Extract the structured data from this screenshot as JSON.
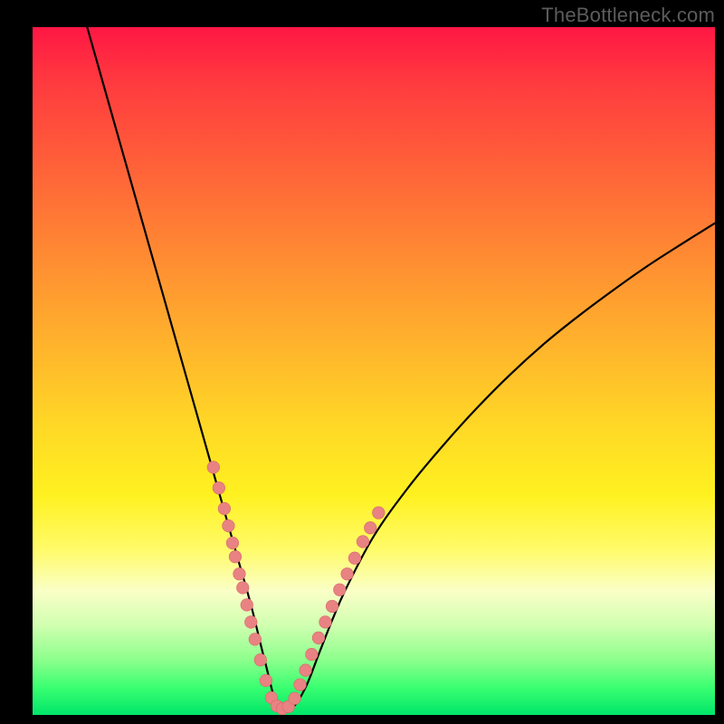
{
  "watermark": "TheBottleneck.com",
  "colors": {
    "background": "#000000",
    "curve": "#000000",
    "dot_fill": "#e98282",
    "dot_stroke": "#d46a6a"
  },
  "chart_data": {
    "type": "line",
    "title": "",
    "xlabel": "",
    "ylabel": "",
    "xlim": [
      0,
      100
    ],
    "ylim": [
      0,
      100
    ],
    "note": "V-shaped bottleneck curve; y appears to represent bottleneck percentage (100 at top, 0 at bottom). Minimum ≈0% near x≈36. Values estimated from pixel positions; no axis ticks or labels are shown in the image.",
    "series": [
      {
        "name": "bottleneck_curve",
        "x": [
          8,
          10,
          12,
          14,
          16,
          18,
          20,
          22,
          24,
          26,
          28,
          30,
          32,
          34,
          36,
          38,
          40,
          42,
          44,
          46,
          50,
          55,
          60,
          65,
          70,
          75,
          80,
          85,
          90,
          95,
          100
        ],
        "y": [
          100,
          93,
          86,
          79,
          72,
          65,
          58,
          51,
          44,
          37,
          30,
          23,
          16,
          8,
          1,
          1,
          4,
          9,
          14,
          18.5,
          26,
          33,
          39,
          44.5,
          49.5,
          54,
          58,
          61.7,
          65.2,
          68.4,
          71.5
        ]
      }
    ],
    "highlight_points": {
      "name": "dotted_segment",
      "note": "Pink/coral dotted overlay along the curve roughly between x≈26 and x≈48 (the lower portion of the V).",
      "points": [
        {
          "x": 26.5,
          "y": 36
        },
        {
          "x": 27.3,
          "y": 33
        },
        {
          "x": 28.1,
          "y": 30
        },
        {
          "x": 28.7,
          "y": 27.5
        },
        {
          "x": 29.3,
          "y": 25
        },
        {
          "x": 29.7,
          "y": 23
        },
        {
          "x": 30.3,
          "y": 20.5
        },
        {
          "x": 30.8,
          "y": 18.5
        },
        {
          "x": 31.4,
          "y": 16
        },
        {
          "x": 32.0,
          "y": 13.5
        },
        {
          "x": 32.6,
          "y": 11
        },
        {
          "x": 33.4,
          "y": 8
        },
        {
          "x": 34.2,
          "y": 5
        },
        {
          "x": 35.0,
          "y": 2.5
        },
        {
          "x": 35.8,
          "y": 1.3
        },
        {
          "x": 36.6,
          "y": 0.9
        },
        {
          "x": 37.5,
          "y": 1.2
        },
        {
          "x": 38.4,
          "y": 2.4
        },
        {
          "x": 39.2,
          "y": 4.4
        },
        {
          "x": 40.0,
          "y": 6.5
        },
        {
          "x": 40.9,
          "y": 8.8
        },
        {
          "x": 41.9,
          "y": 11.2
        },
        {
          "x": 42.9,
          "y": 13.5
        },
        {
          "x": 43.9,
          "y": 15.8
        },
        {
          "x": 45.0,
          "y": 18.2
        },
        {
          "x": 46.1,
          "y": 20.5
        },
        {
          "x": 47.2,
          "y": 22.8
        },
        {
          "x": 48.4,
          "y": 25.2
        },
        {
          "x": 49.5,
          "y": 27.2
        },
        {
          "x": 50.7,
          "y": 29.4
        }
      ]
    }
  }
}
